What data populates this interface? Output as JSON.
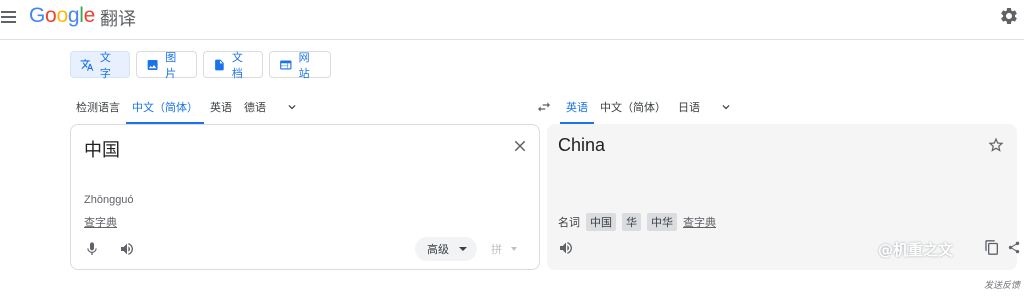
{
  "header": {
    "logo_letters": [
      "G",
      "o",
      "o",
      "g",
      "l",
      "e"
    ],
    "product_name": "翻译",
    "menu_icon": "hamburger-menu-icon",
    "settings_icon": "gear-icon"
  },
  "modes": [
    {
      "label": "文字",
      "icon": "translate-icon",
      "active": true
    },
    {
      "label": "图片",
      "icon": "image-icon",
      "active": false
    },
    {
      "label": "文档",
      "icon": "document-icon",
      "active": false
    },
    {
      "label": "网站",
      "icon": "website-icon",
      "active": false
    }
  ],
  "source_langs": {
    "tabs": [
      "检测语言",
      "中文（简体）",
      "英语",
      "德语"
    ],
    "active_index": 1
  },
  "target_langs": {
    "tabs": [
      "英语",
      "中文（简体）",
      "日语"
    ],
    "active_index": 0
  },
  "source": {
    "text": "中国",
    "romanization": "Zhōngguó",
    "dict_link": "查字典",
    "advanced_label": "高级",
    "ime_label": "拼"
  },
  "target": {
    "text": "China",
    "part_of_speech": "名词",
    "chips": [
      "中国",
      "华",
      "中华"
    ],
    "dict_link": "查字典"
  },
  "watermark": "@机重之文",
  "feedback": "发送反馈",
  "colors": {
    "accent": "#1a73e8",
    "active_mode_bg": "#e8f0fe",
    "target_panel_bg": "#f5f5f5"
  }
}
